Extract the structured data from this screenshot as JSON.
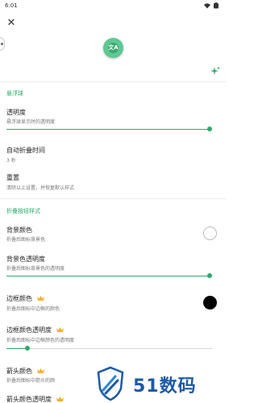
{
  "status_bar": {
    "time": "6:01"
  },
  "header": {
    "close_icon": "close-icon",
    "edge_handle_icon": "drag-handle-icon",
    "preview_badge": "文A",
    "sparkle_icon": "sparkle-icon"
  },
  "accent_color": "#2faa6d",
  "sections": {
    "floating_ball": {
      "header": "悬浮球",
      "opacity": {
        "title": "透明度",
        "desc": "悬浮球显示时的透明度",
        "value": 0.99
      },
      "auto_collapse": {
        "title": "自动折叠时间",
        "value_text": "3 秒"
      },
      "reset": {
        "title": "重置",
        "desc": "清除以上设置，并恢复默认样式"
      }
    },
    "collapsed_style": {
      "header": "折叠按钮样式",
      "bg_color": {
        "title": "背景颜色",
        "desc": "折叠后图标背景色",
        "swatch": "#ffffff"
      },
      "bg_opacity": {
        "title": "背景色透明度",
        "desc": "折叠后图标背景色的透明度",
        "value": 0.99
      },
      "border_color": {
        "title": "边框颜色",
        "desc": "折叠后图标中边框的颜色",
        "swatch": "#000000",
        "premium_icon": "crown-icon"
      },
      "border_opacity": {
        "title": "边框颜色透明度",
        "desc": "折叠后图标中边框颜色的透明度",
        "value": 0.1,
        "premium_icon": "crown-icon"
      },
      "arrow_color": {
        "title": "箭头颜色",
        "desc": "折叠后图标中箭头的颜",
        "premium_icon": "crown-icon"
      },
      "arrow_opacity": {
        "title": "箭头颜色透明度",
        "premium_icon": "crown-icon"
      }
    }
  },
  "watermark": {
    "text": "51数码",
    "icon": "shield-logo-icon"
  }
}
